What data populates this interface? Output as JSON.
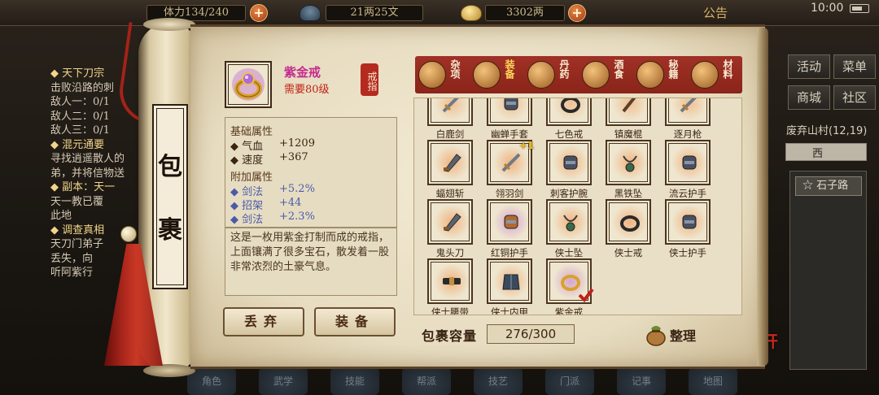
{
  "hud": {
    "stamina": "体力134/240",
    "silver": "21两25文",
    "gold": "3302两",
    "announcement": "公告",
    "clock": "10:00"
  },
  "quests": [
    {
      "type": "header",
      "text": "◆ 天下刀宗"
    },
    {
      "type": "text",
      "text": "击败沿路的刺"
    },
    {
      "type": "text",
      "text": "敌人一：0/1"
    },
    {
      "type": "text",
      "text": "敌人二：0/1"
    },
    {
      "type": "text",
      "text": "敌人三：0/1"
    },
    {
      "type": "header",
      "text": "◆ 混元通要"
    },
    {
      "type": "text",
      "text": "寻找逍遥散人的"
    },
    {
      "type": "text",
      "text": "弟，并将信物送"
    },
    {
      "type": "header",
      "text": "◆ 副本：天一"
    },
    {
      "type": "text",
      "text": "天一教已覆"
    },
    {
      "type": "text",
      "text": "此地"
    },
    {
      "type": "header",
      "text": "◆ 调查真相"
    },
    {
      "type": "text",
      "text": "天刀门弟子"
    },
    {
      "type": "text",
      "text": "丢失，向"
    },
    {
      "type": "text",
      "text": "听阿紫行"
    }
  ],
  "right_menu": {
    "activity": "活动",
    "menu": "菜单",
    "shop": "商城",
    "community": "社区",
    "location": "废弃山村(12,19)",
    "direction": "西",
    "road": "石子路",
    "leave": "离开"
  },
  "bottom_bar": [
    "角色",
    "武学",
    "技能",
    "帮派",
    "技艺",
    "门派",
    "记事",
    "地图"
  ],
  "scroll": {
    "title_top": "包",
    "title_bottom": "裹"
  },
  "selected_item": {
    "name": "紫金戒",
    "requirement": "需要80级",
    "type_seal": "戒指",
    "base_header": "基础属性",
    "base_stats": [
      {
        "label": "◆ 气血",
        "value": "+1209"
      },
      {
        "label": "◆ 速度",
        "value": "+367"
      }
    ],
    "extra_header": "附加属性",
    "extra_stats": [
      {
        "label": "◆ 剑法",
        "value": "+5.2%"
      },
      {
        "label": "◆ 招架",
        "value": "+44"
      },
      {
        "label": "◆ 剑法",
        "value": "+2.3%"
      }
    ],
    "description": "这是一枚用紫金打制而成的戒指，上面镶满了很多宝石，散发着一股非常浓烈的土豪气息。"
  },
  "buttons": {
    "discard": "丢弃",
    "equip": "装备",
    "sort": "整理"
  },
  "tabs": [
    {
      "label": "杂项",
      "icon": "jar-icon",
      "active": false
    },
    {
      "label": "装备",
      "icon": "scroll-sword-icon",
      "active": true
    },
    {
      "label": "丹药",
      "icon": "pills-icon",
      "active": false
    },
    {
      "label": "酒食",
      "icon": "wine-food-icon",
      "active": false
    },
    {
      "label": "秘籍",
      "icon": "books-icon",
      "active": false
    },
    {
      "label": "材料",
      "icon": "crystal-icon",
      "active": false
    }
  ],
  "inventory": [
    {
      "name": "白鹿剑",
      "icon": "sword-icon",
      "glow": "#f0a060"
    },
    {
      "name": "幽蝉手套",
      "icon": "gauntlet-icon",
      "glow": "#f0a060"
    },
    {
      "name": "七色戒",
      "icon": "ring-icon",
      "glow": "#f0a060"
    },
    {
      "name": "镇魔棍",
      "icon": "staff-icon",
      "glow": "#f0a060"
    },
    {
      "name": "逐月枪",
      "icon": "spear-icon",
      "glow": "#f0a060"
    },
    {
      "name": "蝠翅斩",
      "icon": "blade-icon",
      "glow": "#f08a40"
    },
    {
      "name": "翎羽剑",
      "icon": "feather-sword-icon",
      "glow": "#f08a40",
      "badge": "+1"
    },
    {
      "name": "刺客护腕",
      "icon": "bracer-icon",
      "glow": "#f08a40"
    },
    {
      "name": "黑铁坠",
      "icon": "pendant-icon",
      "glow": "#f08a40"
    },
    {
      "name": "流云护手",
      "icon": "guard-icon",
      "glow": "#f08a40"
    },
    {
      "name": "鬼头刀",
      "icon": "broadsword-icon",
      "glow": "#f08a40"
    },
    {
      "name": "红铜护手",
      "icon": "copper-guard-icon",
      "glow": "#c070d0"
    },
    {
      "name": "侠士坠",
      "icon": "pendant-icon",
      "glow": "#f08a40"
    },
    {
      "name": "侠士戒",
      "icon": "ring-icon",
      "glow": "#f08a40"
    },
    {
      "name": "侠士护手",
      "icon": "guard-icon",
      "glow": "#f08a40"
    },
    {
      "name": "侠士腰带",
      "icon": "belt-icon",
      "glow": "#f08a40"
    },
    {
      "name": "侠士内甲",
      "icon": "armor-icon",
      "glow": "#f08a40"
    },
    {
      "name": "紫金戒",
      "icon": "gold-ring-icon",
      "glow": "#c070d0",
      "selected": true
    }
  ],
  "capacity": {
    "label": "包裹容量",
    "value": "276/300"
  },
  "colors": {
    "accent_red": "#a03126",
    "parchment": "#ede3c9",
    "item_name": "#c42a8e",
    "requirement": "#c02216",
    "stat_extra": "#4a5aa8"
  }
}
